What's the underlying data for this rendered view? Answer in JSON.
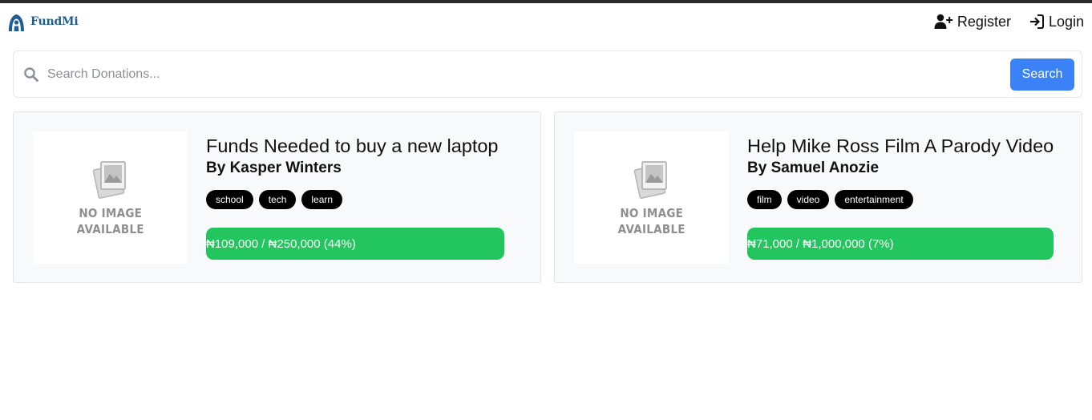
{
  "brand": {
    "name": "FundMi",
    "logo_icon": "fundmi-logo-icon",
    "color": "#1f5e94"
  },
  "nav": {
    "register": {
      "label": "Register",
      "icon": "user-plus-icon"
    },
    "login": {
      "label": "Login",
      "icon": "sign-in-icon"
    }
  },
  "search": {
    "placeholder": "Search Donations...",
    "value": "",
    "button_label": "Search",
    "icon": "search-icon",
    "button_color": "#3b82f6"
  },
  "campaigns": [
    {
      "image": {
        "line1": "NO IMAGE",
        "line2": "AVAILABLE"
      },
      "title": "Funds Needed to buy a new laptop",
      "author": "By Kasper Winters",
      "tags": [
        "school",
        "tech",
        "learn"
      ],
      "progress_text": "₦109,000 / ₦250,000 (44%)",
      "raised": 109000,
      "goal": 250000,
      "percent": 44
    },
    {
      "image": {
        "line1": "NO IMAGE",
        "line2": "AVAILABLE"
      },
      "title": "Help Mike Ross Film A Parody Video",
      "author": "By Samuel Anozie",
      "tags": [
        "film",
        "video",
        "entertainment"
      ],
      "progress_text": "₦71,000 / ₦1,000,000 (7%)",
      "raised": 71000,
      "goal": 1000000,
      "percent": 7
    }
  ],
  "colors": {
    "progress": "#22c55e",
    "tag_bg": "#000000",
    "card_bg": "#f8f9fb"
  }
}
